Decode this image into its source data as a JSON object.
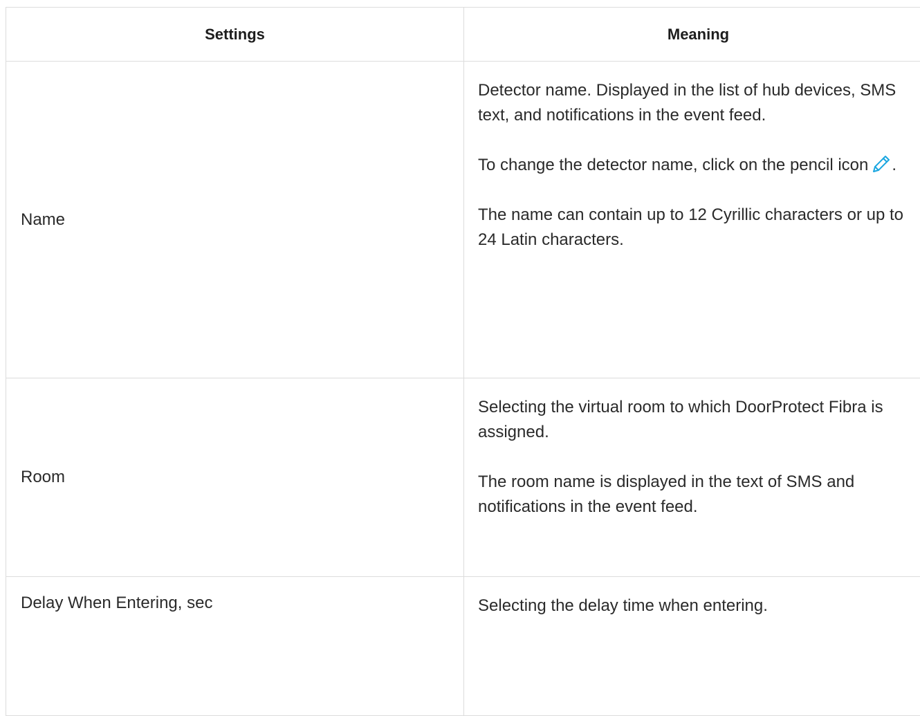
{
  "table": {
    "headers": {
      "settings": "Settings",
      "meaning": "Meaning"
    },
    "rows": [
      {
        "setting": "Name",
        "meaning": [
          "Detector name. Displayed in the list of hub devices, SMS text, and notifications in the event feed.",
          "To change the detector name, click on the pencil",
          "The name can contain up to 12 Cyrillic characters or up to 24 Latin characters."
        ],
        "meaning_icon_prefix": "icon",
        "meaning_icon_suffix": "."
      },
      {
        "setting": "Room",
        "meaning": [
          "Selecting the virtual room to which DoorProtect Fibra is assigned.",
          "The room name is displayed in the text of SMS and notifications in the event feed."
        ]
      },
      {
        "setting": "Delay When Entering, sec",
        "meaning": [
          "Selecting the delay time when entering."
        ]
      }
    ]
  },
  "icons": {
    "pencil": "pencil-icon"
  },
  "colors": {
    "accent": "#1aa6e0",
    "border": "#dcdcdc",
    "text": "#2a2a2a"
  }
}
